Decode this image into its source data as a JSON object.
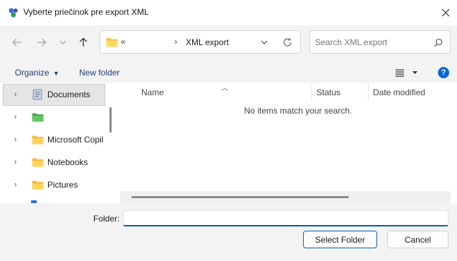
{
  "window": {
    "title": "Vyberte priečinok pre export XML"
  },
  "address": {
    "overflow": "«",
    "current": "XML export"
  },
  "search": {
    "placeholder": "Search XML export"
  },
  "commands": {
    "organize": "Organize",
    "new_folder": "New folder"
  },
  "nav_pane": {
    "items": [
      {
        "label": "Documents",
        "icon": "documents-icon",
        "selected": true
      },
      {
        "label": "",
        "icon": "folder-green-icon",
        "selected": false
      },
      {
        "label": "Microsoft Copil",
        "icon": "folder-icon",
        "selected": false
      },
      {
        "label": "Notebooks",
        "icon": "folder-icon",
        "selected": false
      },
      {
        "label": "Pictures",
        "icon": "folder-icon",
        "selected": false
      }
    ]
  },
  "columns": {
    "name": "Name",
    "status": "Status",
    "date_modified": "Date modified"
  },
  "empty_message": "No items match your search.",
  "footer": {
    "folder_label": "Folder:",
    "folder_value": "",
    "select_button": "Select Folder",
    "cancel_button": "Cancel"
  },
  "colors": {
    "accent": "#005fb8",
    "help_blue": "#0a68d4",
    "folder_yellow": "#f4c542",
    "folder_green": "#5cb85c"
  }
}
